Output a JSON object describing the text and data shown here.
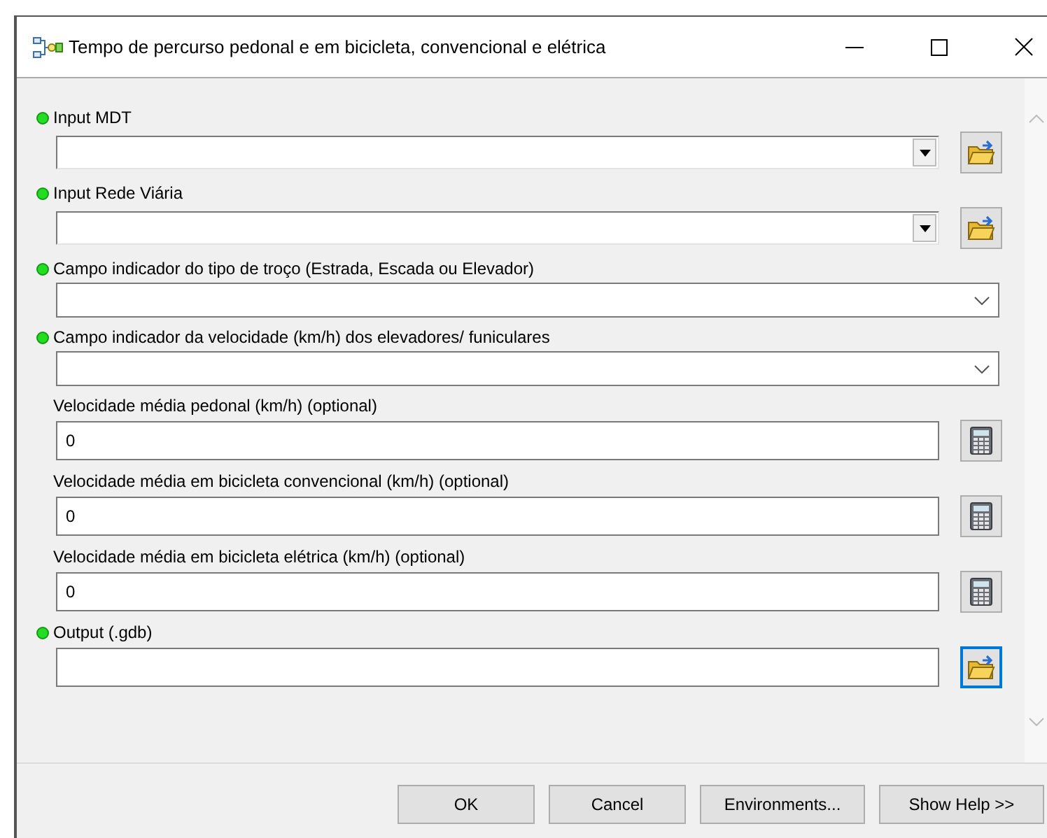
{
  "window": {
    "title": "Tempo de percurso pedonal e em bicicleta, convencional e elétrica"
  },
  "parameters": [
    {
      "kind": "dropdown",
      "label": "Input MDT",
      "required": true,
      "button": {
        "kind": "browse",
        "focused": false
      }
    },
    {
      "kind": "dropdown",
      "label": "Input Rede Viária",
      "required": true,
      "button": {
        "kind": "browse",
        "focused": false
      }
    },
    {
      "kind": "combo",
      "label": "Campo indicador do tipo de troço (Estrada, Escada ou Elevador)",
      "required": true
    },
    {
      "kind": "combo",
      "label": "Campo indicador da velocidade (km/h) dos elevadores/ funiculares",
      "required": true
    },
    {
      "kind": "text",
      "label": "Velocidade média pedonal (km/h) (optional)",
      "required": false,
      "value": "0",
      "button": {
        "kind": "calculator",
        "focused": false
      }
    },
    {
      "kind": "text",
      "label": "Velocidade média em bicicleta convencional (km/h) (optional)",
      "required": false,
      "value": "0",
      "button": {
        "kind": "calculator",
        "focused": false
      }
    },
    {
      "kind": "text",
      "label": "Velocidade média em bicicleta elétrica (km/h) (optional)",
      "required": false,
      "value": "0",
      "button": {
        "kind": "calculator",
        "focused": false
      }
    },
    {
      "kind": "text",
      "label": "Output (.gdb)",
      "required": true,
      "button": {
        "kind": "browse",
        "focused": true
      }
    }
  ],
  "buttons": [
    "OK",
    "Cancel",
    "Environments...",
    "Show Help >>"
  ]
}
